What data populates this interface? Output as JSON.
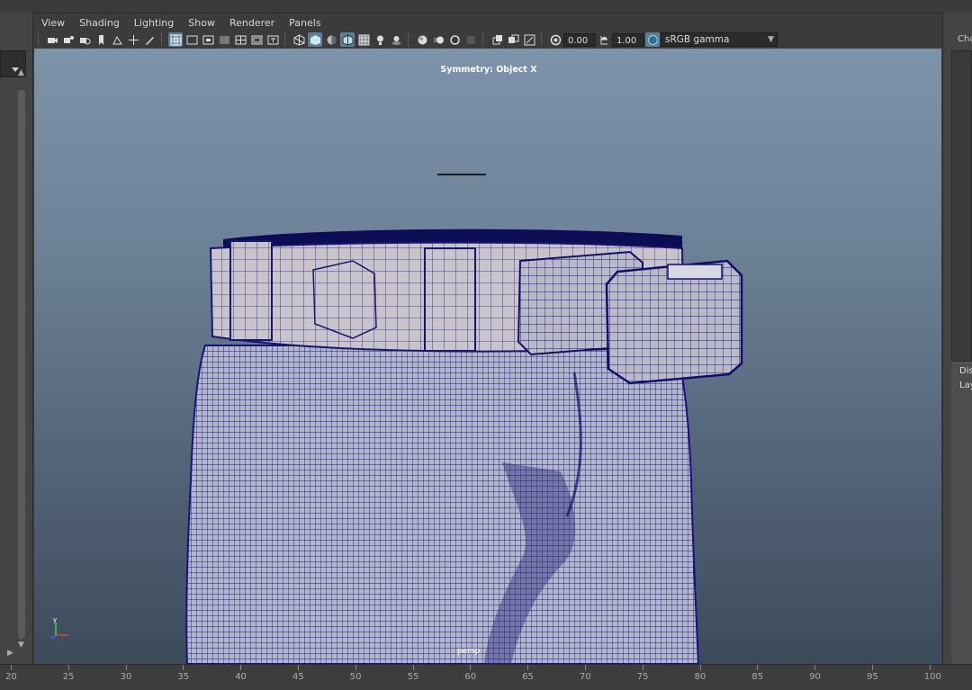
{
  "menubar": {
    "items": [
      "View",
      "Shading",
      "Lighting",
      "Show",
      "Renderer",
      "Panels"
    ]
  },
  "toolbar": {
    "exposure": "0.00",
    "gamma": "1.00",
    "color_space": "sRGB gamma"
  },
  "viewport": {
    "symmetry_label": "Symmetry: Object X",
    "camera_label": "persp"
  },
  "right_panel": {
    "tab_top": "Cha",
    "tab_display": "Dis",
    "tab_layers": "Lay"
  },
  "timeline": {
    "ticks": [
      "20",
      "25",
      "30",
      "35",
      "40",
      "45",
      "50",
      "55",
      "60",
      "65",
      "70",
      "75",
      "80",
      "85",
      "90",
      "95",
      "100"
    ]
  }
}
